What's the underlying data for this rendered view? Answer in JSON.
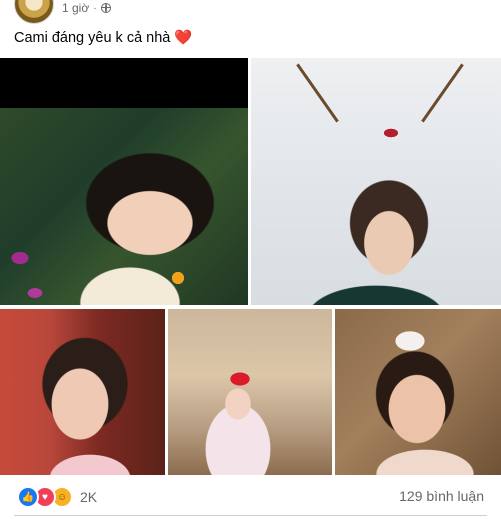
{
  "post": {
    "time": "1 giờ",
    "separator": "·",
    "caption": "Cami đáng yêu k cả nhà",
    "caption_emoji": "❤️"
  },
  "reactions": {
    "icons": [
      "like-icon",
      "love-icon",
      "care-icon"
    ],
    "count": "2K",
    "comments": "129 bình luận"
  },
  "colors": {
    "like": "#1877f2",
    "love": "#f33e58",
    "care": "#f7b125",
    "meta_text": "#65676b"
  }
}
